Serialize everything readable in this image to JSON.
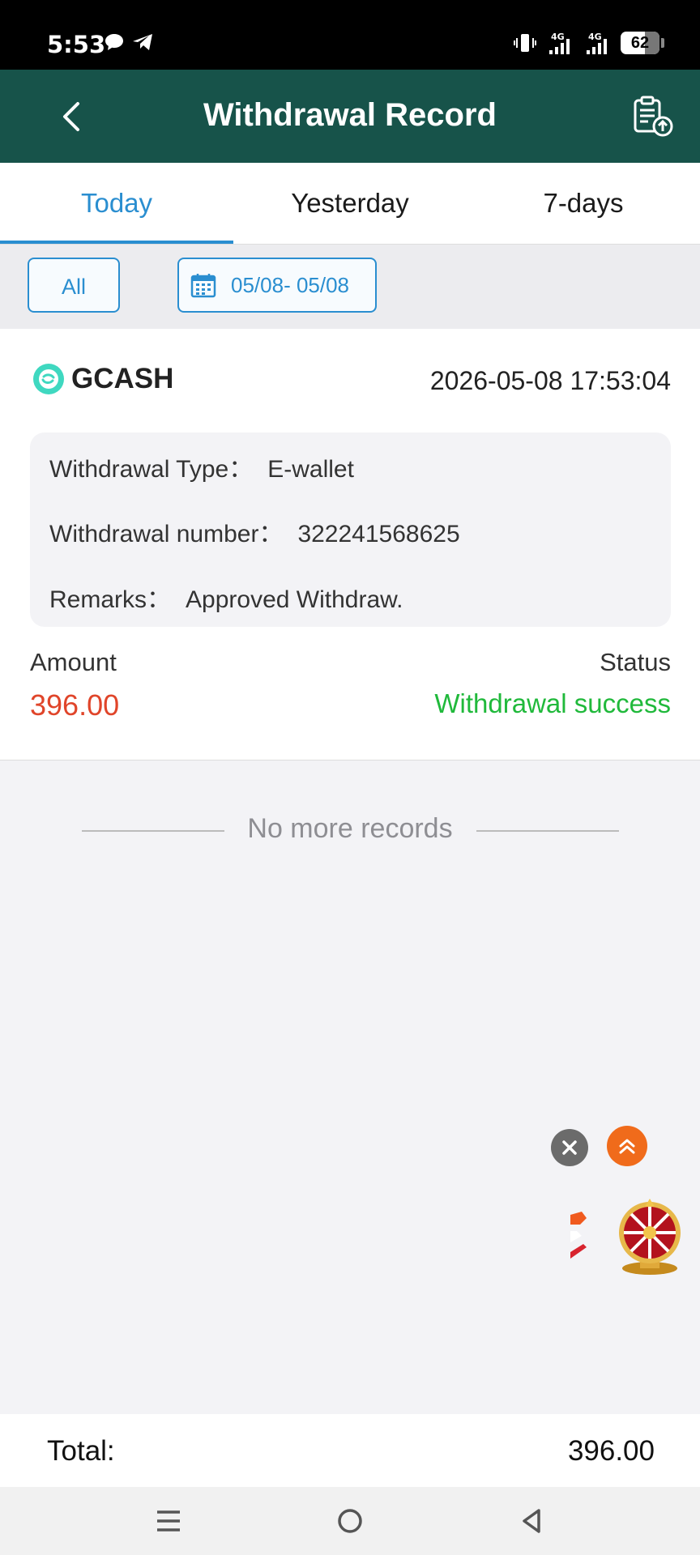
{
  "status_bar": {
    "time": "5:53",
    "left_icons": [
      "chat-bubble-icon",
      "telegram-icon"
    ],
    "right_icons": [
      "vibrate-icon",
      "signal-4g-icon",
      "signal-4g-icon"
    ],
    "battery": "62"
  },
  "header": {
    "title": "Withdrawal Record",
    "back_icon": "chevron-left-icon",
    "action_icon": "clipboard-upload-icon"
  },
  "tabs": [
    {
      "label": "Today",
      "active": true
    },
    {
      "label": "Yesterday",
      "active": false
    },
    {
      "label": "7-days",
      "active": false
    }
  ],
  "filters": {
    "type_label": "All",
    "date_range": "05/08- 05/08",
    "date_icon": "calendar-icon"
  },
  "record": {
    "method": "GCASH",
    "datetime": "2026-05-08 17:53:04",
    "type_label": "Withdrawal Type：",
    "type_value": "E-wallet",
    "number_label": "Withdrawal number：",
    "number_value": "322241568625",
    "remarks_label": "Remarks：",
    "remarks_value": "Approved Withdraw.",
    "amount_label": "Amount",
    "amount_value": "396.00",
    "status_label": "Status",
    "status_value": "Withdrawal success"
  },
  "list_end_text": "No more records",
  "totals": {
    "label": "Total:",
    "value": "396.00"
  },
  "colors": {
    "header_bg": "#17534a",
    "accent_blue": "#2a8ed0",
    "amount_red": "#e0452a",
    "success_green": "#20b93b"
  },
  "nav_icons": [
    "menu-icon",
    "home-circle-icon",
    "back-triangle-icon"
  ]
}
